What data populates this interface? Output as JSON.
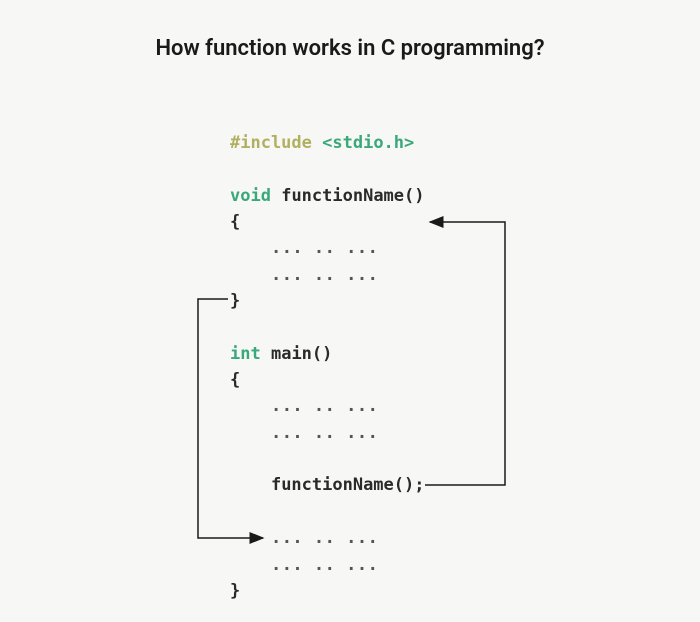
{
  "title": "How function works in C programming?",
  "code": {
    "include": "#include",
    "header": "<stdio.h>",
    "voidKw": "void",
    "fnDecl": "functionName()",
    "openBrace": "{",
    "closeBrace": "}",
    "dots": "... .. ...",
    "intKw": "int",
    "mainDecl": "main()",
    "fnCall": "functionName();"
  }
}
